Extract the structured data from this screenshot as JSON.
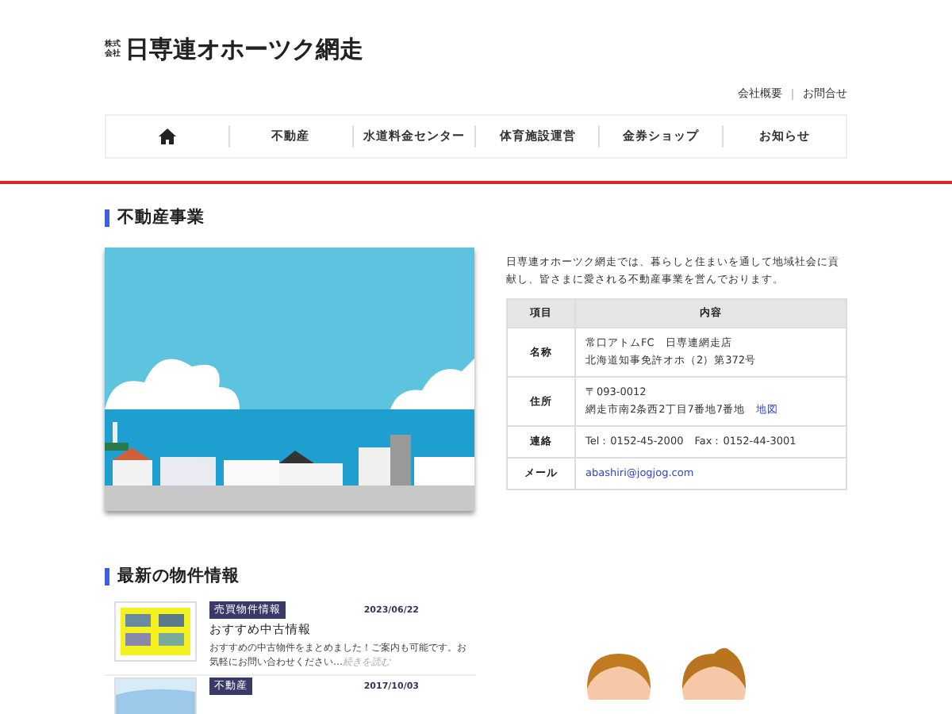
{
  "logo": {
    "prefix": "株式会社",
    "name": "日専連オホーツク網走"
  },
  "top_links": [
    "会社概要",
    "お問合せ"
  ],
  "nav": [
    {
      "kind": "home"
    },
    {
      "kind": "text",
      "label": "不動産"
    },
    {
      "kind": "text",
      "label": "水道料金センター"
    },
    {
      "kind": "text",
      "label": "体育施設運営"
    },
    {
      "kind": "text",
      "label": "金券ショップ"
    },
    {
      "kind": "text",
      "label": "お知らせ"
    }
  ],
  "section": {
    "title": "不動産事業",
    "intro": "日専連オホーツク網走では、暮らしと住まいを通して地域社会に貢献し、皆さまに愛される不動産事業を営んでおります。",
    "table": {
      "columns": [
        "項目",
        "内容"
      ],
      "rows": [
        {
          "kind": "text",
          "label": "名称",
          "lines": [
            "常口アトムFC　日専連網走店",
            "北海道知事免許オホ（2）第372号"
          ]
        },
        {
          "kind": "text",
          "label": "住所",
          "lines": [
            "〒093-0012",
            "網走市南2条西2丁目7番地7番地"
          ],
          "link": "地図"
        },
        {
          "kind": "text",
          "label": "連絡",
          "lines": [
            "Tel：0152-45-2000　Fax：0152-44-3001"
          ]
        },
        {
          "kind": "email",
          "label": "メール",
          "lines": [
            "abashiri@jogjog.com"
          ]
        }
      ]
    }
  },
  "news": {
    "title": "最新の物件情報",
    "items": [
      {
        "tag": "売買物件情報",
        "date": "2023/06/22",
        "title": "おすすめ中古情報",
        "desc": "おすすめの中古物件をまとめました！ご案内も可能です。お気軽にお問い合わせください…",
        "more": "続きを読む"
      },
      {
        "tag": "不動産",
        "date": "2017/10/03"
      }
    ]
  }
}
